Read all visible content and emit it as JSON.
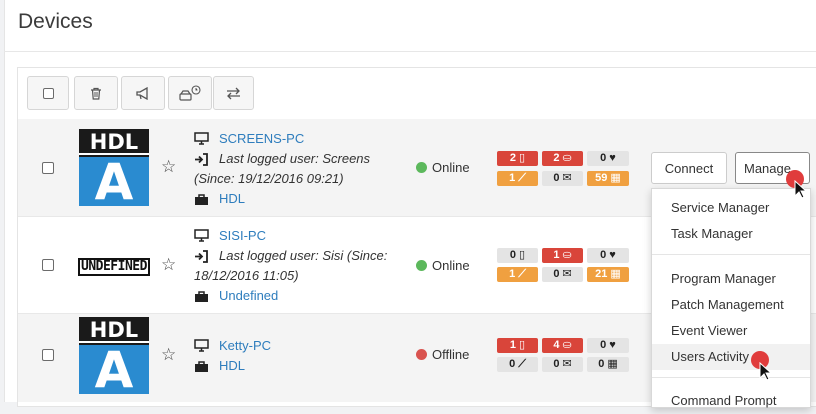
{
  "page": {
    "title": "Devices"
  },
  "toolbar": [
    {
      "name": "select-all-checkbox",
      "icon": "checkbox-icon"
    },
    {
      "name": "delete-button",
      "icon": "trash-icon"
    },
    {
      "name": "announce-button",
      "icon": "megaphone-icon"
    },
    {
      "name": "scheduled-scan-button",
      "icon": "scan-clock-icon"
    },
    {
      "name": "transfer-button",
      "icon": "transfer-icon"
    }
  ],
  "devices": [
    {
      "name": "SCREENS-PC",
      "logo": "HDL",
      "last_user": "Last logged user: Screens",
      "since": "(Since: 19/12/2016 09:21)",
      "group": "HDL",
      "status": "Online",
      "status_color": "#5cb85c",
      "badges": [
        [
          "2",
          "2",
          "0"
        ],
        [
          "1",
          "0",
          "59"
        ]
      ]
    },
    {
      "name": "SISI-PC",
      "logo": "UNDEFINED",
      "last_user": "Last logged user: Sisi (Since:",
      "since": "18/12/2016 11:05)",
      "group": "Undefined",
      "status": "Online",
      "status_color": "#5cb85c",
      "badges": [
        [
          "0",
          "1",
          "0"
        ],
        [
          "1",
          "0",
          "21"
        ]
      ]
    },
    {
      "name": "Ketty-PC",
      "logo": "HDL",
      "group": "HDL",
      "status": "Offline",
      "status_color": "#d9534f",
      "badges": [
        [
          "1",
          "4",
          "0"
        ],
        [
          "0",
          "0",
          "0"
        ]
      ]
    }
  ],
  "actions": {
    "connect": "Connect",
    "manage": "Manage"
  },
  "manage_menu": {
    "items": [
      "Service Manager",
      "Task Manager",
      "Program Manager",
      "Patch Management",
      "Event Viewer",
      "Users Activity",
      "Command Prompt"
    ]
  },
  "colors": {
    "link": "#2e7dbd",
    "badge_red": "#d9453a",
    "badge_orange": "#f0a040",
    "badge_grey": "#e4e4e4",
    "online": "#5cb85c",
    "offline": "#d9534f"
  }
}
